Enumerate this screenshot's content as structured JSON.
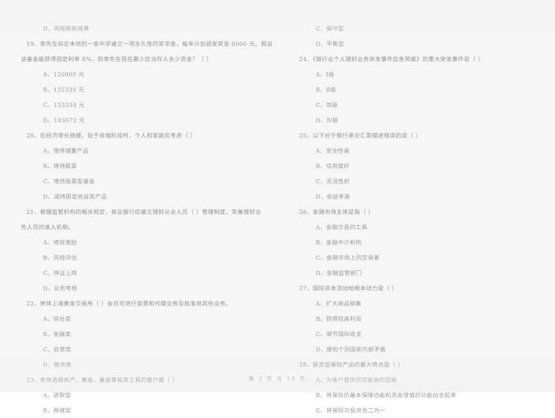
{
  "document": {
    "type": "exam-paper",
    "language": "zh-CN",
    "footer": "第 3 页 共 18 页"
  },
  "left_column": {
    "items": [
      {
        "kind": "option",
        "text": "D、风险损失结果"
      },
      {
        "kind": "question",
        "text": "19、李先生拟在本地的一家中学建立一项永久性的奖学金，每年计划颁发奖金 8000 元。假设"
      },
      {
        "kind": "question_cont",
        "text": "该基金能获得固定利率 6%，则李先生现在最少应当存入多少资金？（      ）"
      },
      {
        "kind": "option",
        "text": "A、120000 元"
      },
      {
        "kind": "option",
        "text": "B、132335 元"
      },
      {
        "kind": "option",
        "text": "C、133334 元"
      },
      {
        "kind": "option",
        "text": "D、145672 元"
      },
      {
        "kind": "question",
        "text": "20、在经济增长放缓、处于收缩阶段时，个人和家庭应考虑（      ）"
      },
      {
        "kind": "option",
        "text": "A、增持储蓄产品"
      },
      {
        "kind": "option",
        "text": "B、增持股票"
      },
      {
        "kind": "option",
        "text": "C、增持股票型基金"
      },
      {
        "kind": "option",
        "text": "D、减持固定收益类产品"
      },
      {
        "kind": "question",
        "text": "21、根据监管机构的相关规定，商业银行应建立理财从业人员（      ）管理制度，完善理财业"
      },
      {
        "kind": "question_cont",
        "text": "务人员的准入机制。"
      },
      {
        "kind": "option",
        "text": "A、绩效激励"
      },
      {
        "kind": "option",
        "text": "B、风险评估"
      },
      {
        "kind": "option",
        "text": "C、持证上岗"
      },
      {
        "kind": "option",
        "text": "D、业务考核"
      },
      {
        "kind": "question",
        "text": "22、宋体上海黄金交易所（      ）会员可进行自营和代理业务及批准地其他业务。"
      },
      {
        "kind": "option",
        "text": "A、综合类"
      },
      {
        "kind": "option",
        "text": "B、金融类"
      },
      {
        "kind": "option",
        "text": "C、自营类"
      },
      {
        "kind": "option",
        "text": "D、做市商"
      },
      {
        "kind": "question",
        "text": "23、宋体选择房产、黄金、基金等投资工具的客户属（      ）"
      },
      {
        "kind": "option",
        "text": "A、进取型"
      },
      {
        "kind": "option",
        "text": "B、稳健型"
      }
    ]
  },
  "right_column": {
    "items": [
      {
        "kind": "option",
        "text": "C、保守型"
      },
      {
        "kind": "option",
        "text": "D、平衡型"
      },
      {
        "kind": "question",
        "text": "24、《银行业个人理财业务突发事件应急预案》的重大突发事件是（      ）"
      },
      {
        "kind": "option",
        "text": "A、Ⅰ级"
      },
      {
        "kind": "option",
        "text": "B、Ⅱ级"
      },
      {
        "kind": "option",
        "text": "C、Ⅲ级"
      },
      {
        "kind": "option",
        "text": "D、Ⅳ级"
      },
      {
        "kind": "question",
        "text": "25、以下对于银行承兑汇票描述错误的是（      ）"
      },
      {
        "kind": "option",
        "text": "A、安全性高"
      },
      {
        "kind": "option",
        "text": "B、信用度好"
      },
      {
        "kind": "option",
        "text": "C、灵活性好"
      },
      {
        "kind": "option",
        "text": "D、收益率高"
      },
      {
        "kind": "question",
        "text": "26、金融市场主体是指（      ）"
      },
      {
        "kind": "option",
        "text": "A、金融交易的工具"
      },
      {
        "kind": "option",
        "text": "B、金融中介机构"
      },
      {
        "kind": "option",
        "text": "C、金融市场上的交易者"
      },
      {
        "kind": "option",
        "text": "D、金融监管部门"
      },
      {
        "kind": "question",
        "text": "27、国际资本流动地根本动力是（      ）"
      },
      {
        "kind": "option",
        "text": "A、扩大商品销售"
      },
      {
        "kind": "option",
        "text": "B、获得较高利润"
      },
      {
        "kind": "option",
        "text": "C、调节国际收支"
      },
      {
        "kind": "option",
        "text": "D、缓和个别国家内部矛盾"
      },
      {
        "kind": "question",
        "text": "28、投资型保险产品的最大特点是（      ）"
      },
      {
        "kind": "option",
        "text": "A、为客户提供尽可能高的回报"
      },
      {
        "kind": "option",
        "text": "B、将保险的基本保障功能和资金增值的功能结合起来"
      },
      {
        "kind": "option",
        "text": "C、将保险与投资合二为一"
      }
    ]
  }
}
